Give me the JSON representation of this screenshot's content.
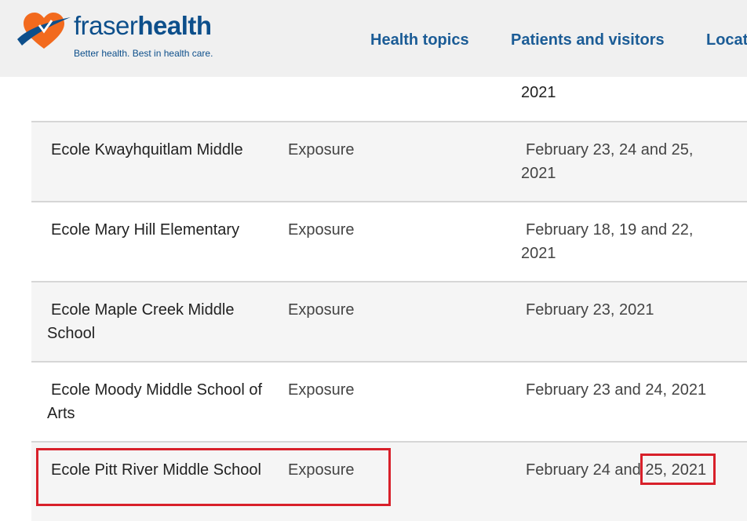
{
  "header": {
    "brand_light": "fraser",
    "brand_bold": "health",
    "tagline": "Better health. Best in health care.",
    "nav": [
      "Health topics",
      "Patients and visitors",
      "Locat"
    ]
  },
  "table": {
    "partial_row": {
      "date_tail": "2021"
    },
    "rows": [
      {
        "name": "Ecole Kwayhquitlam Middle",
        "type": "Exposure",
        "dates": "February 23, 24 and 25, 2021"
      },
      {
        "name": "Ecole Mary Hill Elementary",
        "type": "Exposure",
        "dates": "February 18, 19 and 22, 2021"
      },
      {
        "name": "Ecole Maple Creek Middle School",
        "type": "Exposure",
        "dates": "February 23, 2021"
      },
      {
        "name": "Ecole Moody Middle School of Arts",
        "type": "Exposure",
        "dates": "February 23 and 24, 2021"
      },
      {
        "name": "Ecole Pitt River Middle School",
        "type": "Exposure",
        "dates": "February 24 and 25, 2021"
      }
    ]
  },
  "colors": {
    "brand": "#0d4f8b",
    "nav": "#1b5c96",
    "accent_orange": "#f26a1e",
    "highlight": "#d8202a"
  }
}
